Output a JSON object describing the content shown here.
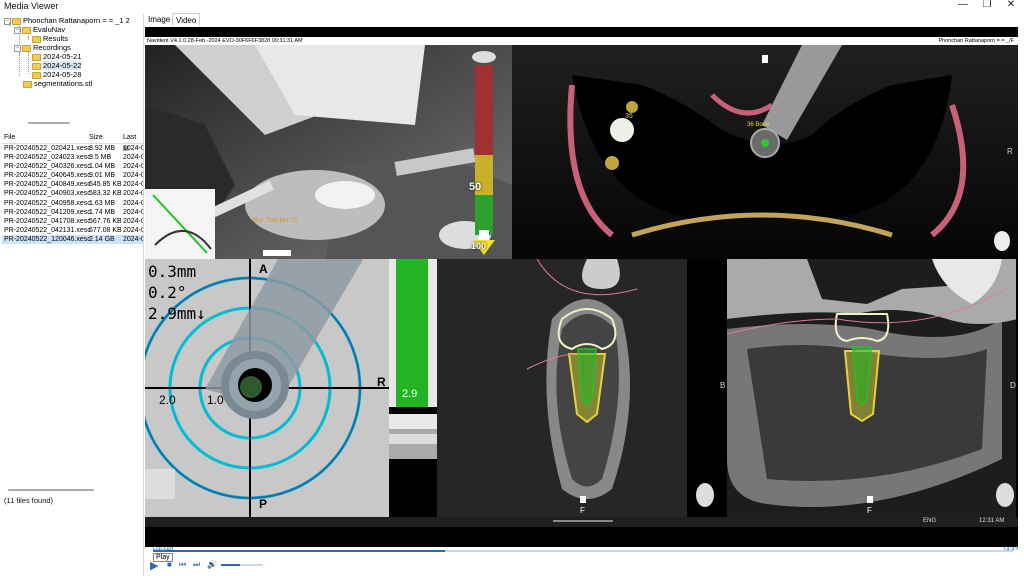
{
  "window": {
    "title": "Media Viewer"
  },
  "tree": [
    {
      "label": "Phonchan Rattanaporn   =    =     _1 2",
      "expanded": true
    },
    {
      "label": "EvaluNav",
      "expanded": true
    },
    {
      "label": "Results"
    },
    {
      "label": "Recordings",
      "expanded": true
    },
    {
      "label": "2024-05-21"
    },
    {
      "label": "2024-05-22"
    },
    {
      "label": "2024-05-28"
    },
    {
      "label": "segmentations.stl"
    }
  ],
  "filelist": {
    "headers": {
      "file": "File",
      "size": "Size",
      "last": "Last M"
    },
    "rows": [
      {
        "file": "PR-20240522_020421.xesc",
        "size": "8.92 MB",
        "last": "2024-0"
      },
      {
        "file": "PR-20240522_024023.xesc",
        "size": "9.5 MB",
        "last": "2024-0"
      },
      {
        "file": "PR-20240522_040326.xesc",
        "size": "1.04 MB",
        "last": "2024-0"
      },
      {
        "file": "PR-20240522_040645.xesc",
        "size": "9.01 MB",
        "last": "2024-0"
      },
      {
        "file": "PR-20240522_040849.xesc",
        "size": "645.85 KB",
        "last": "2024-0"
      },
      {
        "file": "PR-20240522_040903.xesc",
        "size": "583.32 KB",
        "last": "2024-0"
      },
      {
        "file": "PR-20240522_040958.xesc",
        "size": "1.63 MB",
        "last": "2024-0"
      },
      {
        "file": "PR-20240522_041209.xesc",
        "size": "1.74 MB",
        "last": "2024-0"
      },
      {
        "file": "PR-20240522_041708.xesc",
        "size": "567.76 KB",
        "last": "2024-0"
      },
      {
        "file": "PR-20240522_042131.xesc",
        "size": "677.08 KB",
        "last": "2024-0"
      },
      {
        "file": "PR-20240522_120046.xesc",
        "size": "2.14 GB",
        "last": "2024-0"
      }
    ],
    "count": "(11 files found)"
  },
  "tabs": [
    {
      "label": "Image"
    },
    {
      "label": "Video",
      "active": true
    }
  ],
  "video": {
    "header": "Navident V4.1.0 28-Feb.-2024 EVO-30F6F6F3828 00:31:31 AM",
    "patient": "Phonchan Rattanaporn  =  =  _/F",
    "depth_scale": [
      "50",
      "100"
    ],
    "tracker_label": "Bur Tracker IC",
    "implant_labels": [
      "35",
      "36 Bone"
    ],
    "side_R": "R",
    "target": {
      "lines": [
        "0.3mm",
        "0.2°",
        "2.9mm↓"
      ],
      "axis": {
        "A": "A",
        "P": "P",
        "R": "R"
      },
      "ring_labels": [
        "2.0",
        "1.0"
      ]
    },
    "depth_value": "2.9",
    "cross_labels": {
      "B": "B",
      "D": "D",
      "F1": "F",
      "F2": "F"
    },
    "taskbar": {
      "lang": "ENG",
      "time": "12:31 AM"
    }
  },
  "player": {
    "status": "Paused",
    "time": "14:43",
    "play_label": "Play",
    "progress": 0.34,
    "volume": 0.45
  },
  "colors": {
    "accent": "#2a6ab8",
    "green": "#22b422",
    "cyan": "#00bcd4",
    "yellow": "#e6d23c",
    "pink": "#e07a9a"
  }
}
